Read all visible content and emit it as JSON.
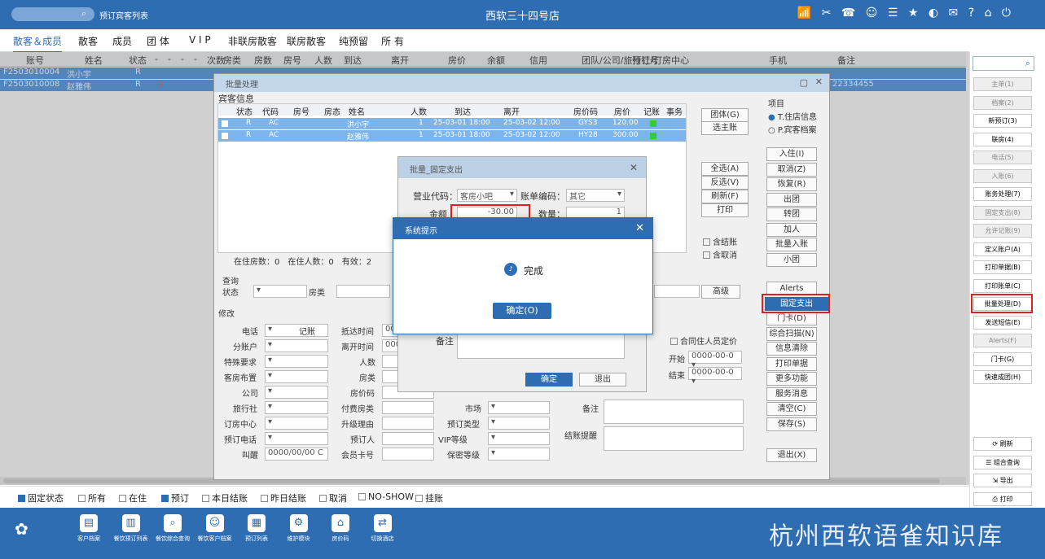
{
  "top": {
    "search_icon": "search-icon",
    "func": "预订宾客列表",
    "hotel": "西软三十四号店",
    "icons": "📶 ✂ ☎ ☺ ☰ ★ ◐ ✉ ? ⌂ ⏻"
  },
  "tabs": [
    "散客＆成员",
    "散客",
    "成员",
    "团 体",
    "V I P",
    "非联房散客",
    "联房散客",
    "纯预留",
    "所 有"
  ],
  "grid": {
    "headers": [
      "账号",
      "姓名",
      "状态",
      "-",
      "-",
      "-",
      "-",
      "次数",
      "房类",
      "房数",
      "房号",
      "人数",
      "到达",
      "离开",
      "房价",
      "余额",
      "信用",
      "团队/公司/旅行社/订房中心",
      "预订号",
      "手机",
      "备注"
    ],
    "rows": [
      {
        "acct": "F2503010004",
        "name": "洪小宇",
        "status": "R",
        "mobile": ""
      },
      {
        "acct": "F2503010008",
        "name": "赵雅伟",
        "status": "R",
        "d": "D",
        "mobile": "22334455"
      }
    ]
  },
  "dlg": {
    "title": "批量处理",
    "guest_info": "宾客信息",
    "item_label": "项目",
    "radio1": "T.住店信息",
    "radio2": "P.宾客档案",
    "inner_headers": [
      "状态",
      "代码",
      "房号",
      "房态",
      "姓名",
      "人数",
      "到达",
      "离开",
      "房价码",
      "房价",
      "记账",
      "事务"
    ],
    "inner_rows": [
      {
        "st": "R",
        "code": "AC",
        "name": "洪小宇",
        "n": "1",
        "arr": "25-03-01 18:00",
        "dep": "25-03-02 12:00",
        "rc": "GYS3",
        "price": "120.00"
      },
      {
        "st": "R",
        "code": "AC",
        "name": "赵雅伟",
        "n": "1",
        "arr": "25-03-01 18:00",
        "dep": "25-03-02 12:00",
        "rc": "HY28",
        "price": "300.00"
      }
    ],
    "summary": "在住房数：0　在住人数：0　有效：2",
    "btn_group": "团体(G)",
    "btn_main": "选主账",
    "btn_all": "全选(A)",
    "btn_inv": "反选(V)",
    "btn_refresh": "刷新(F)",
    "btn_print": "打印",
    "chk_acct": "含结账",
    "chk_cancel": "含取消",
    "actions": [
      "入住(I)",
      "取消(Z)",
      "恢复(R)",
      "出团",
      "转团",
      "加人",
      "批量入账",
      "小团"
    ],
    "actions2": [
      "Alerts",
      "固定支出",
      "门卡(D)",
      "综合扫描(N)",
      "信息清除",
      "打印单据",
      "更多功能",
      "服务消息",
      "清空(C)",
      "保存(S)"
    ],
    "exit": "退出(X)",
    "query": "查询",
    "q_status": "状态",
    "q_roomtype": "房类",
    "q_adv": "高级",
    "modify": "修改",
    "mod_labels_a": [
      "电话",
      "分账户",
      "特殊要求",
      "客房布置",
      "公司",
      "旅行社",
      "订房中心",
      "预订电话",
      "叫醒"
    ],
    "mod_labels_b": [
      "抵达时间",
      "离开时间",
      "人数",
      "房类",
      "房价码",
      "付费房类",
      "升级理由",
      "预订人",
      "会员卡号"
    ],
    "mod_labels_c": [
      "市场",
      "预订类型",
      "VIP等级",
      "保密等级"
    ],
    "mod_labels_d": [
      "备注",
      "结账提醒"
    ],
    "record": "记账",
    "arrive_val": "00",
    "leave_val": "000",
    "wake_val": "0000/00/00 C",
    "same_price": "合同住人员定价",
    "start": "开始",
    "end": "结束",
    "date_val": "0000-00-0"
  },
  "fix": {
    "title": "批量_固定支出",
    "biz_label": "营业代码：",
    "biz_val": "客房小吧",
    "bill_label": "账单编码：",
    "bill_val": "其它",
    "amt_label": "金额",
    "amt_val": "-30.00",
    "qty_label": "数量：",
    "qty_val": "1",
    "note_label": "备注",
    "ok": "确定",
    "exit": "退出"
  },
  "msg": {
    "title": "系统提示",
    "text": "完成",
    "ok": "确定(O)",
    "icon": "bell-icon"
  },
  "right": {
    "buttons": [
      {
        "t": "主单(1)",
        "d": true
      },
      {
        "t": "档案(2)",
        "d": true
      },
      {
        "t": "新预订(3)",
        "d": false
      },
      {
        "t": "联房(4)",
        "d": false
      },
      {
        "t": "电话(5)",
        "d": true
      },
      {
        "t": "入账(6)",
        "d": true
      },
      {
        "t": "账务处理(7)",
        "d": false
      },
      {
        "t": "固定支出(8)",
        "d": true
      },
      {
        "t": "允许记账(9)",
        "d": true
      },
      {
        "t": "定义账户(A)",
        "d": false
      },
      {
        "t": "打印单据(B)",
        "d": false
      },
      {
        "t": "打印账单(C)",
        "d": false
      },
      {
        "t": "批量处理(D)",
        "d": false
      },
      {
        "t": "发送短信(E)",
        "d": false
      },
      {
        "t": "Alerts(F)",
        "d": true
      },
      {
        "t": "门卡(G)",
        "d": false
      },
      {
        "t": "快速成团(H)",
        "d": false
      }
    ],
    "bottom": [
      "⟳ 刷新",
      "☰ 组合查询",
      "⇲ 导出",
      "⎙ 打印"
    ]
  },
  "status": {
    "items": [
      {
        "t": "固定状态",
        "on": true
      },
      {
        "t": "所有",
        "on": false
      },
      {
        "t": "在住",
        "on": false
      },
      {
        "t": "预订",
        "on": true
      },
      {
        "t": "本日结账",
        "on": false
      },
      {
        "t": "昨日结账",
        "on": false
      },
      {
        "t": "取消",
        "on": false
      },
      {
        "t": "NO-SHOW",
        "on": false
      },
      {
        "t": "挂账",
        "on": false
      }
    ]
  },
  "dock": [
    {
      "t": "客户档案",
      "i": "▤"
    },
    {
      "t": "餐饮预订列表",
      "i": "▥"
    },
    {
      "t": "餐饮综合查询",
      "i": "⌕"
    },
    {
      "t": "餐饮客户档案",
      "i": "☺"
    },
    {
      "t": "预订列表",
      "i": "▦"
    },
    {
      "t": "维护模块",
      "i": "⚙"
    },
    {
      "t": "房价码",
      "i": "⌂"
    },
    {
      "t": "切换酒店",
      "i": "⇄"
    }
  ],
  "brand": "杭州西软语雀知识库"
}
